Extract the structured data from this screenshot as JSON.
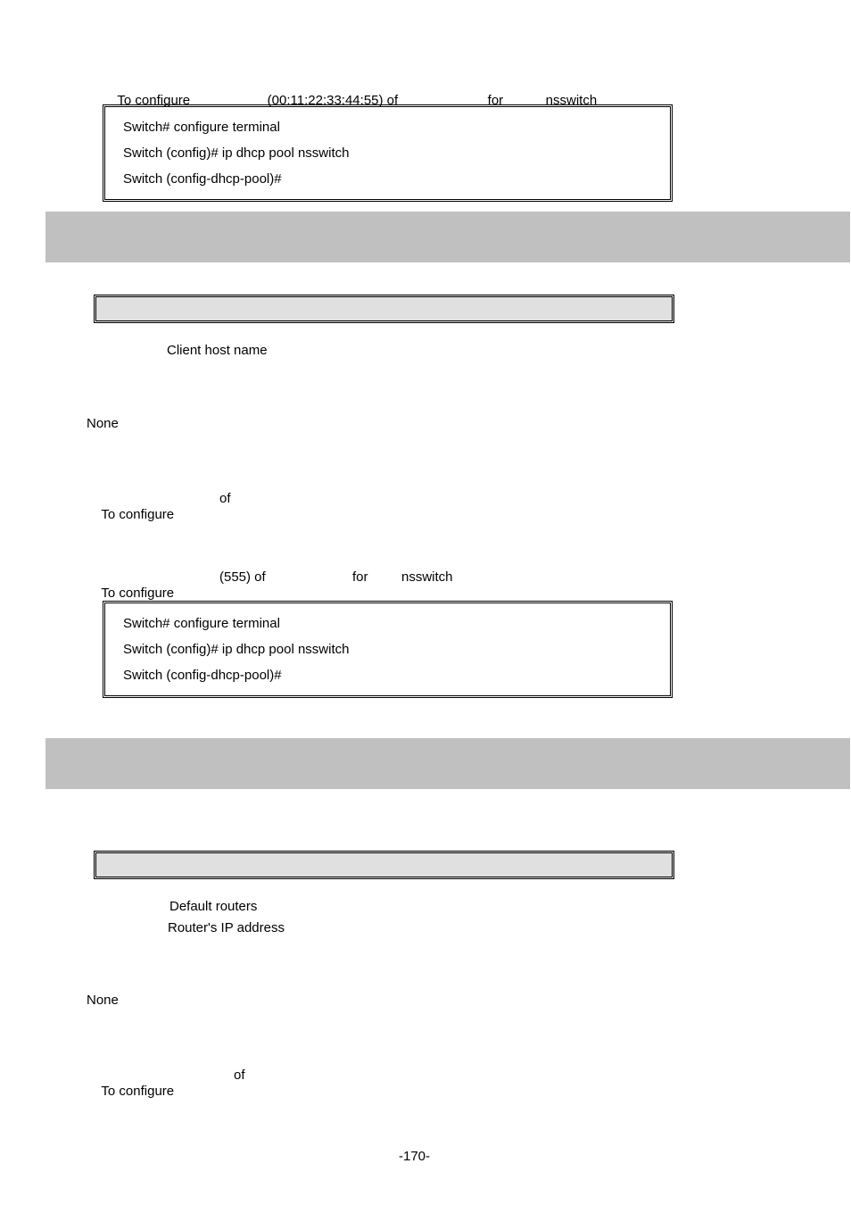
{
  "top": {
    "line_parts": {
      "to_configure": "To configure ",
      "mac": "(00:11:22:33:44:55) of ",
      "for": "for ",
      "pool": "nsswitch"
    },
    "code": {
      "l1": "Switch# configure terminal",
      "l2": "Switch (config)# ip dhcp pool nsswitch",
      "l3": "Switch (config-dhcp-pool)#"
    }
  },
  "section_clientname": {
    "params": {
      "desc": "Client host name"
    },
    "default": "None",
    "usage_line": {
      "to_configure": "To configure ",
      "of": "of "
    },
    "example_line": {
      "to_configure": "To configure ",
      "num": "(555) of ",
      "for": "for ",
      "pool": "nsswitch"
    },
    "code": {
      "l1": "Switch# configure terminal",
      "l2": "Switch (config)# ip dhcp pool nsswitch",
      "l3": "Switch (config-dhcp-pool)#"
    }
  },
  "section_defaultrouter": {
    "params": {
      "desc1": "Default routers",
      "desc2": "Router's IP address"
    },
    "default": "None",
    "usage_line": {
      "to_configure": "To configure ",
      "of": "of "
    }
  },
  "page_number": "-170-"
}
